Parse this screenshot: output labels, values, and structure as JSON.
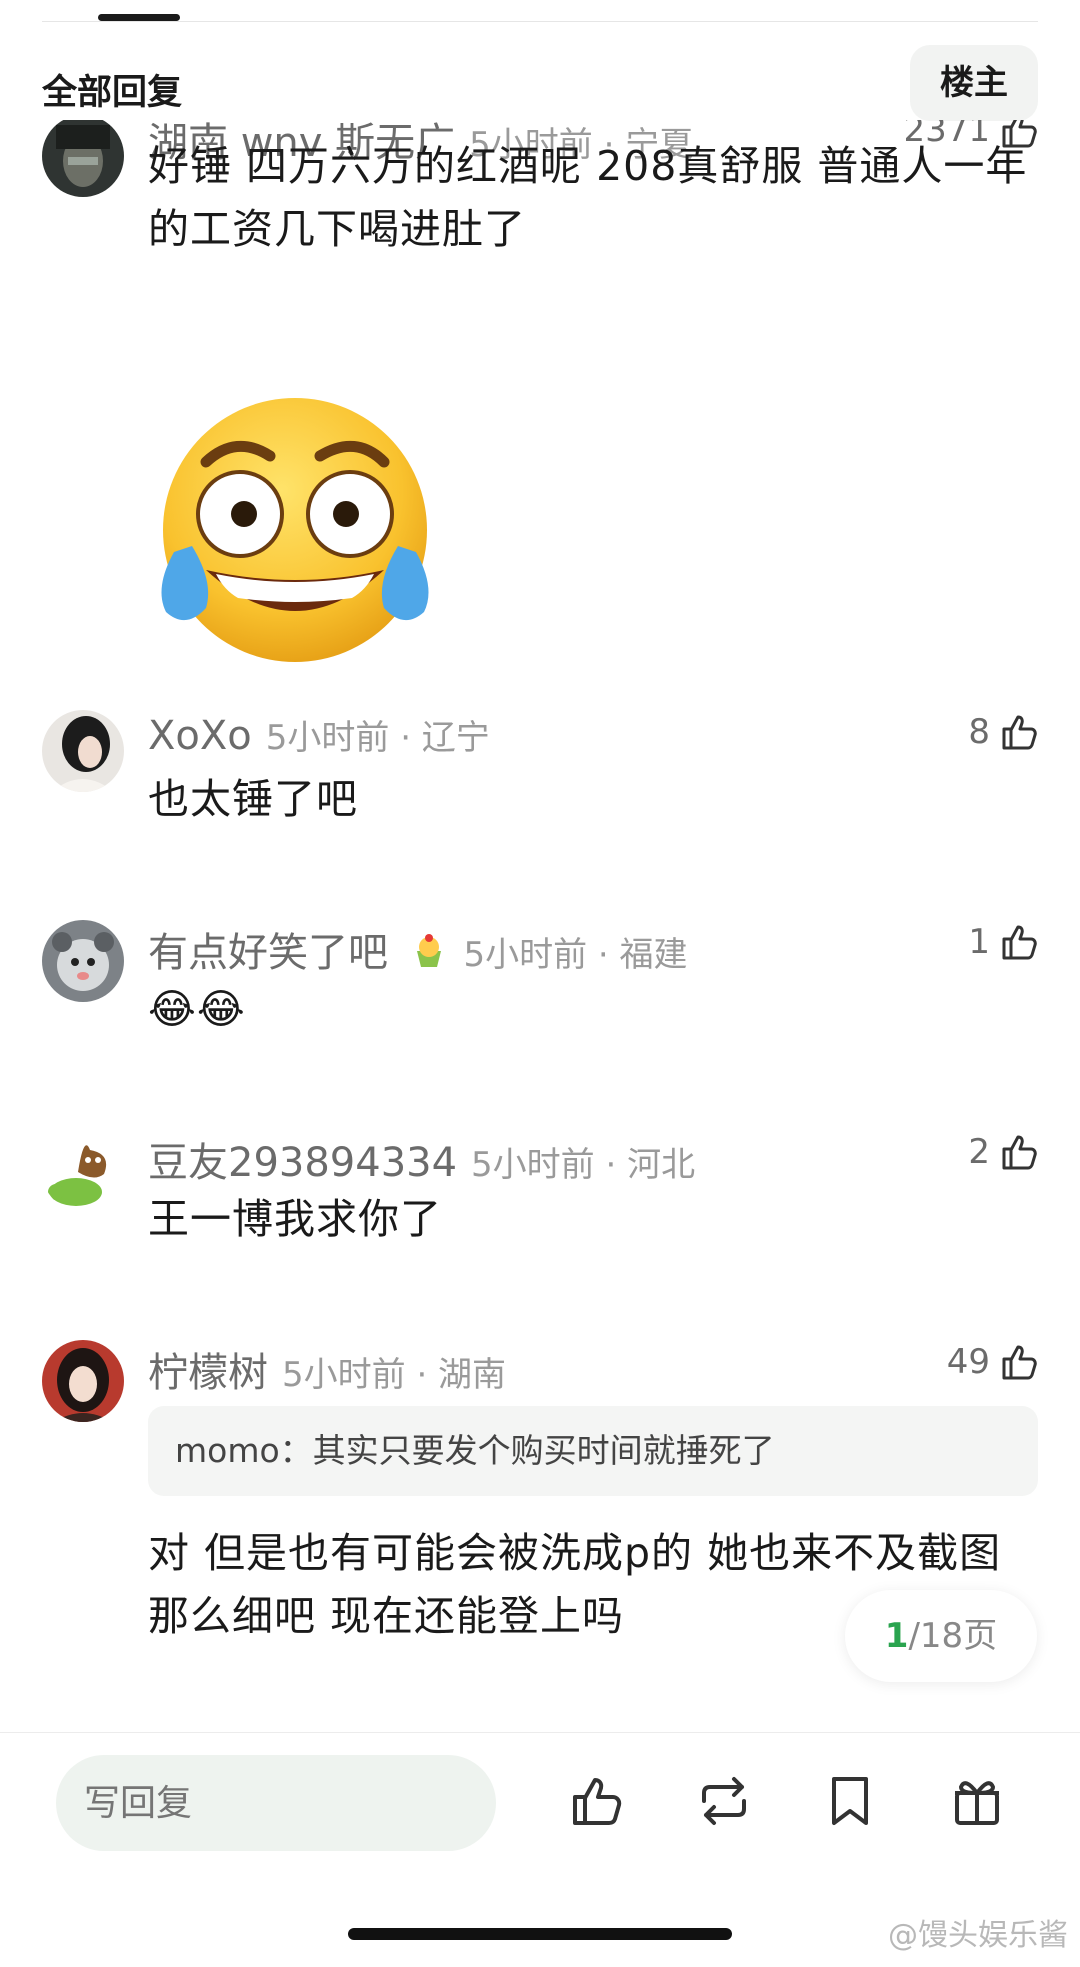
{
  "header": {
    "title": "全部回复",
    "op_label": "楼主"
  },
  "comments": [
    {
      "username": "湖南 wnv 斯无广",
      "time_location": "5小时前 · 宁夏",
      "likes": "2371",
      "text": "好锤 四万六万的红酒呢 208真舒服 普通人一年的工资几下喝进肚了",
      "has_sticker": true
    },
    {
      "username": "XoXo",
      "time_location": "5小时前 · 辽宁",
      "likes": "8",
      "text": "也太锤了吧"
    },
    {
      "username": "有点好笑了吧",
      "badge_icon": "cupcake-icon",
      "time_location": "5小时前 · 福建",
      "likes": "1",
      "text": "😂😂"
    },
    {
      "username": "豆友293894334",
      "time_location": "5小时前 · 河北",
      "likes": "2",
      "text": "王一博我求你了"
    },
    {
      "username": "柠檬树",
      "time_location": "5小时前 · 湖南",
      "likes": "49",
      "quote": "momo：其实只要发个购买时间就捶死了",
      "text": "对 但是也有可能会被洗成p的 她也来不及截图那么细吧 现在还能登上吗"
    }
  ],
  "pagination": {
    "current": "1",
    "total": "/18页"
  },
  "bottom_bar": {
    "reply_placeholder": "写回复",
    "icons": [
      "thumbs-up-icon",
      "repost-icon",
      "bookmark-icon",
      "gift-icon"
    ]
  },
  "watermark": "@馒头娱乐酱",
  "colors": {
    "accent_green": "#2aa44f",
    "text_gray": "#8a8a8a"
  }
}
